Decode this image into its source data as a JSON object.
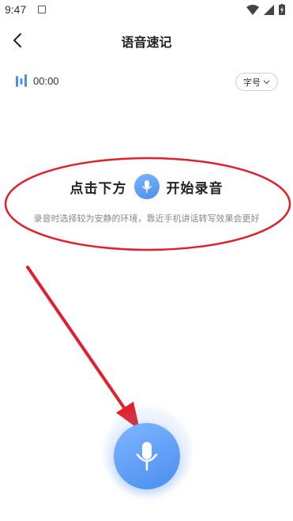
{
  "status_bar": {
    "time": "9:47",
    "icons": [
      "notification-a-icon",
      "wifi-icon",
      "signal-icon",
      "battery-charging-icon"
    ]
  },
  "header": {
    "title": "语音速记",
    "back_icon": "chevron-left-icon"
  },
  "recording": {
    "timer": "00:00",
    "font_size_button": "字号",
    "waveform_icon": "waveform-icon",
    "dropdown_icon": "chevron-down-icon"
  },
  "hint": {
    "prefix": "点击下方",
    "suffix": "开始录音",
    "subtitle": "录音时选择较为安静的环境，靠近手机讲话转写效果会更好"
  },
  "mic_button": {
    "icon": "microphone-icon"
  },
  "colors": {
    "accent": "#4a8ef0",
    "annotation_red": "#e0202a",
    "text_primary": "#222222",
    "text_secondary": "#888888"
  }
}
